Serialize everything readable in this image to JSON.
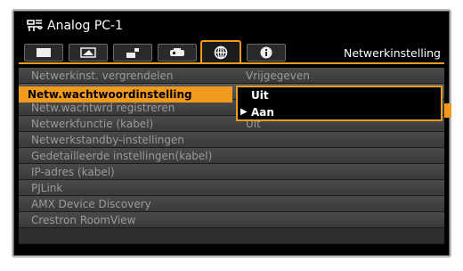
{
  "header": {
    "source_title": "Analog PC-1",
    "source_icon": "monitor-input-icon"
  },
  "tabs": [
    {
      "icon": "picture-quality-icon",
      "active": false
    },
    {
      "icon": "image-adjust-icon",
      "active": false
    },
    {
      "icon": "installation-icon",
      "active": false
    },
    {
      "icon": "system-settings-icon",
      "active": false
    },
    {
      "icon": "network-globe-icon",
      "active": true
    },
    {
      "icon": "information-icon",
      "active": false
    }
  ],
  "active_tab_label": "Netwerkinstelling",
  "menu": {
    "items": [
      {
        "label": "Netwerkinst. vergrendelen",
        "value": "Vrijgegeven"
      },
      {
        "label": "Netw.wachtwoordinstelling",
        "value": ""
      },
      {
        "label": "Netw.wachtwrd registreren",
        "value": ""
      },
      {
        "label": "Netwerkfunctie (kabel)",
        "value": "Uit"
      },
      {
        "label": "Netwerkstandby-instellingen",
        "value": ""
      },
      {
        "label": "Gedetailleerde instellingen(kabel)",
        "value": ""
      },
      {
        "label": "IP-adres (kabel)",
        "value": ""
      },
      {
        "label": "PJLink",
        "value": ""
      },
      {
        "label": "AMX Device Discovery",
        "value": ""
      },
      {
        "label": "Crestron RoomView",
        "value": ""
      }
    ]
  },
  "popup": {
    "options": [
      "Uit",
      "Aan"
    ],
    "highlighted": "Aan"
  },
  "colors": {
    "accent": "#f19a1e",
    "background": "#000000",
    "row": "#444444"
  }
}
